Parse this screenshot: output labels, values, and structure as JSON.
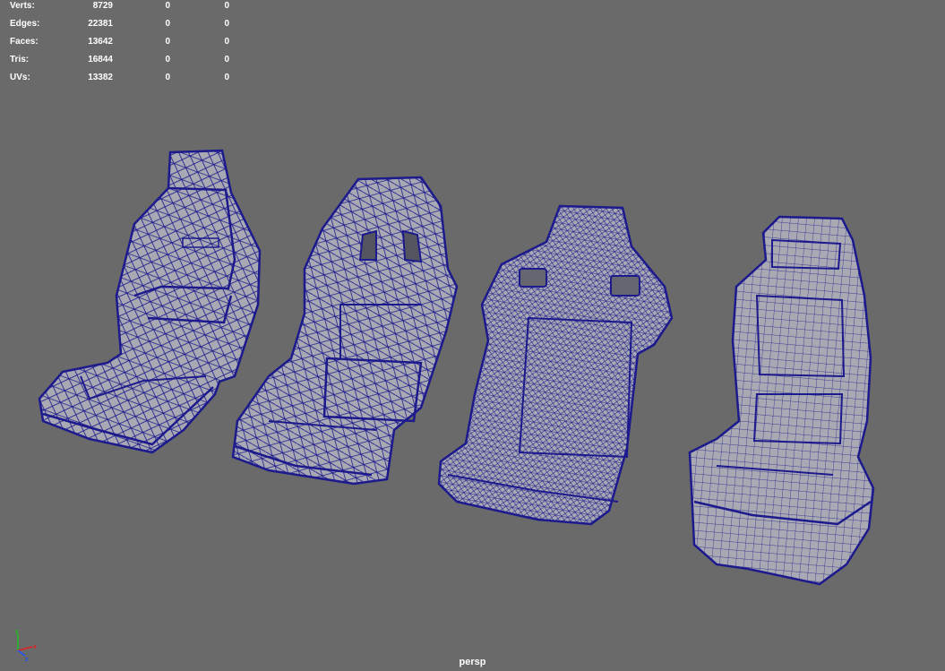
{
  "hud": {
    "rows": [
      {
        "label": "Verts:",
        "c1": "8729",
        "c2": "0",
        "c3": "0"
      },
      {
        "label": "Edges:",
        "c1": "22381",
        "c2": "0",
        "c3": "0"
      },
      {
        "label": "Faces:",
        "c1": "13642",
        "c2": "0",
        "c3": "0"
      },
      {
        "label": "Tris:",
        "c1": "16844",
        "c2": "0",
        "c3": "0"
      },
      {
        "label": "UVs:",
        "c1": "13382",
        "c2": "0",
        "c3": "0"
      }
    ]
  },
  "viewport": {
    "camera": "persp",
    "axis_labels": {
      "x": "x",
      "y": "y",
      "z": "z"
    }
  },
  "colors": {
    "background": "#6a6a6a",
    "wire": "#1c1a8c",
    "surface": "#a9a9b3",
    "surface_dark": "#8a8a94",
    "axis_x": "#e02020",
    "axis_y": "#20c020",
    "axis_z": "#2050ff"
  }
}
